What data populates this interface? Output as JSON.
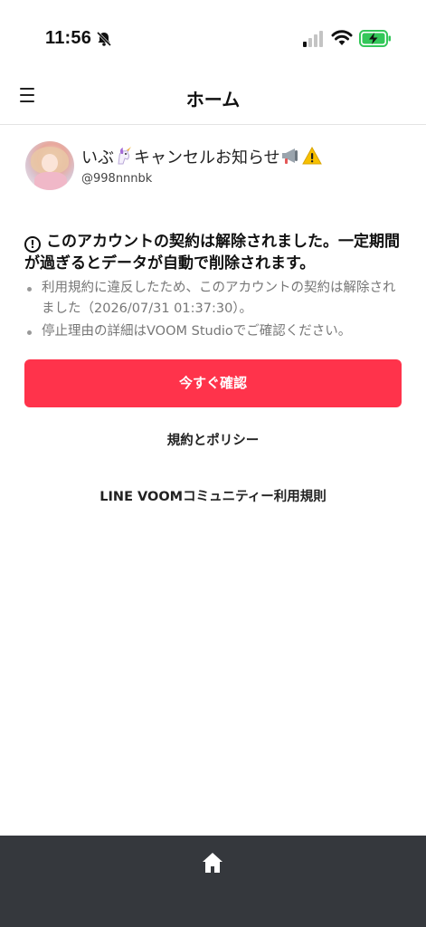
{
  "status_bar": {
    "time": "11:56",
    "icons": [
      "bell-slash-icon",
      "signal-icon",
      "wifi-icon",
      "battery-charging-icon"
    ]
  },
  "header": {
    "title": "ホーム",
    "menu_icon": "hamburger-menu-icon"
  },
  "profile": {
    "name_part1": "いぶ",
    "name_part2": "キャンセルお知らせ",
    "handle": "@998nnnbk",
    "emojis": [
      "unicorn-emoji",
      "megaphone-emoji",
      "warning-emoji"
    ]
  },
  "notice": {
    "title": "このアカウントの契約は解除されました。一定期間が過ぎるとデータが自動で削除されます。",
    "bullets": [
      "利用規約に違反したため、このアカウントの契約は解除されました（2026/07/31 01:37:30）。",
      "停止理由の詳細はVOOM Studioでご確認ください。"
    ]
  },
  "actions": {
    "confirm_label": "今すぐ確認",
    "policy_label": "規約とポリシー",
    "community_label": "LINE VOOMコミュニティー利用規則"
  },
  "colors": {
    "accent": "#ff334b",
    "bottom_bar": "#35383d",
    "battery_green": "#34c759"
  }
}
